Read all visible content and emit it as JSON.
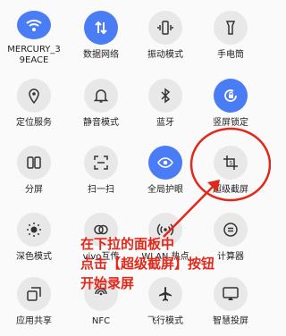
{
  "tiles": [
    {
      "label": "MERCURY_3\n9EACE",
      "icon": "wifi-icon",
      "active": true
    },
    {
      "label": "数据网络",
      "icon": "mobile-data-icon",
      "active": true
    },
    {
      "label": "振动模式",
      "icon": "vibrate-icon",
      "active": false
    },
    {
      "label": "手电筒",
      "icon": "flashlight-icon",
      "active": false
    },
    {
      "label": "定位服务",
      "icon": "location-icon",
      "active": false
    },
    {
      "label": "静音模式",
      "icon": "bell-icon",
      "active": false
    },
    {
      "label": "蓝牙",
      "icon": "bluetooth-icon",
      "active": false
    },
    {
      "label": "竖屏锁定",
      "icon": "rotation-lock-icon",
      "active": true
    },
    {
      "label": "分屏",
      "icon": "split-screen-icon",
      "active": false
    },
    {
      "label": "扫一扫",
      "icon": "scan-icon",
      "active": false
    },
    {
      "label": "全局护眼",
      "icon": "eye-icon",
      "active": true
    },
    {
      "label": "超级截屏",
      "icon": "super-screenshot-icon",
      "active": false
    },
    {
      "label": "深色模式",
      "icon": "dark-mode-icon",
      "active": false
    },
    {
      "label": "vivo互传",
      "icon": "vivo-share-icon",
      "active": false
    },
    {
      "label": "WLAN 热点",
      "icon": "hotspot-icon",
      "active": false
    },
    {
      "label": "计算器",
      "icon": "calculator-icon",
      "active": false
    },
    {
      "label": "应用共享",
      "icon": "app-share-icon",
      "active": false
    },
    {
      "label": "NFC",
      "icon": "nfc-icon",
      "active": false
    },
    {
      "label": "飞行模式",
      "icon": "airplane-icon",
      "active": false
    },
    {
      "label": "智慧投屏",
      "icon": "screen-cast-icon",
      "active": false
    }
  ],
  "annotation": {
    "lines": [
      "在下拉的面板中",
      "点击【超级截屏】按钮",
      "开始录屏"
    ],
    "color": "#e2281a"
  },
  "colors": {
    "active": "#4a7cf6",
    "inactive": "#e8e8e8"
  }
}
